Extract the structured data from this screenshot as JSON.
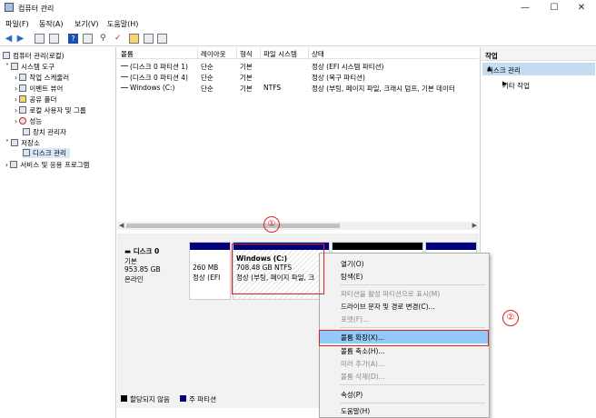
{
  "window": {
    "title": "컴퓨터 관리",
    "minimize": "—",
    "maximize": "☐",
    "close": "✕"
  },
  "menu": [
    "파일(F)",
    "동작(A)",
    "보기(V)",
    "도움말(H)"
  ],
  "tree": [
    {
      "label": "컴퓨터 관리(로컬)"
    },
    {
      "label": "시스템 도구"
    },
    {
      "label": "작업 스케줄러"
    },
    {
      "label": "이벤트 뷰어"
    },
    {
      "label": "공유 폴더"
    },
    {
      "label": "로컬 사용자 및 그룹"
    },
    {
      "label": "성능"
    },
    {
      "label": "장치 관리자"
    },
    {
      "label": "저장소"
    },
    {
      "label": "디스크 관리"
    },
    {
      "label": "서비스 및 응용 프로그램"
    }
  ],
  "columns": [
    "볼륨",
    "레이아웃",
    "형식",
    "파일 시스템",
    "상태"
  ],
  "volumes": [
    {
      "name": "(디스크 0 파티션 1)",
      "layout": "단순",
      "type": "기본",
      "fs": "",
      "status": "정상 (EFI 시스템 파티션)"
    },
    {
      "name": "(디스크 0 파티션 4)",
      "layout": "단순",
      "type": "기본",
      "fs": "",
      "status": "정상 (복구 파티션)"
    },
    {
      "name": "Windows (C:)",
      "layout": "단순",
      "type": "기본",
      "fs": "NTFS",
      "status": "정상 (부팅, 페이지 파일, 크래시 덤프, 기본 데이터"
    }
  ],
  "disk": {
    "name": "디스크 0",
    "type": "기본",
    "size": "953.85 GB",
    "status": "온라인",
    "partitions": [
      {
        "line1": "260 MB",
        "line2": "정상 (EFI"
      },
      {
        "title": "Windows  (C:)",
        "line1": "708.48 GB NTFS",
        "line2": "정상 (부팅, 페이지 파일, 크"
      }
    ]
  },
  "legend": [
    {
      "label": "할당되지 않음",
      "color": "#000000"
    },
    {
      "label": "주 파티션",
      "color": "#00007f"
    }
  ],
  "actions": {
    "title": "작업",
    "section": "디스크 관리",
    "item": "기타 작업"
  },
  "context_menu": [
    {
      "label": "열기(O)",
      "enabled": true
    },
    {
      "label": "탐색(E)",
      "enabled": true
    },
    {
      "label": "파티션을 활성 파티션으로 표시(M)",
      "enabled": false
    },
    {
      "label": "드라이브 문자 및 경로 변경(C)...",
      "enabled": true
    },
    {
      "label": "포맷(F)...",
      "enabled": false
    },
    {
      "label": "볼륨 확장(X)...",
      "enabled": true,
      "highlighted": true
    },
    {
      "label": "볼륨 축소(H)...",
      "enabled": true
    },
    {
      "label": "미러 추가(A)...",
      "enabled": false
    },
    {
      "label": "볼륨 삭제(D)...",
      "enabled": false
    },
    {
      "label": "속성(P)",
      "enabled": true
    },
    {
      "label": "도움말(H)",
      "enabled": true
    }
  ],
  "annotations": {
    "one": "①",
    "two": "②"
  },
  "colors": {
    "accent_red": "#d92323",
    "primary_partition": "#00007f",
    "highlight": "#91c9f7"
  }
}
